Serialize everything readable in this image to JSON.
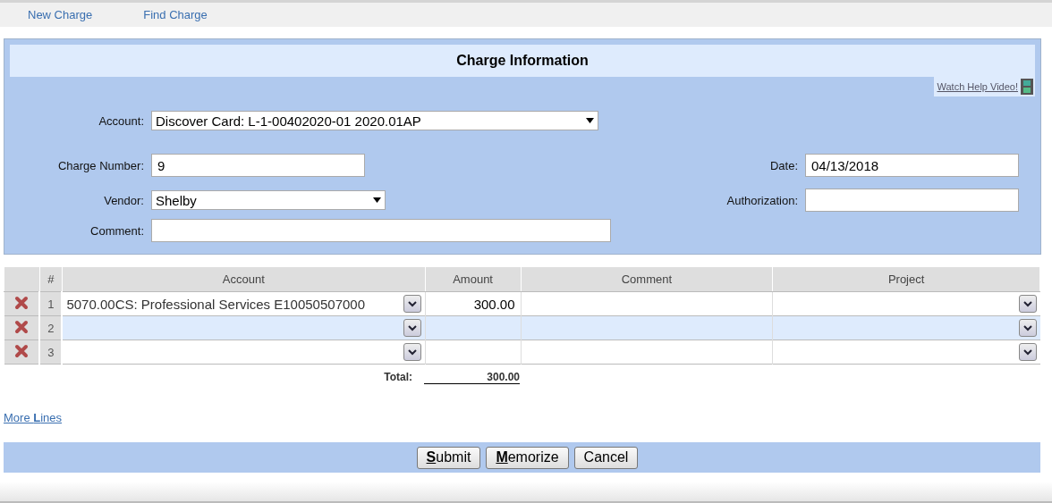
{
  "nav": [
    "New Charge",
    "Find Charge"
  ],
  "panel": {
    "title": "Charge Information",
    "help_link": "Watch Help Video!"
  },
  "fields": {
    "account": {
      "label": "Account:",
      "value": "Discover Card: L-1-00402020-01 2020.01AP"
    },
    "charge_number": {
      "label": "Charge Number:",
      "value": "9"
    },
    "date": {
      "label": "Date:",
      "value": "04/13/2018"
    },
    "vendor": {
      "label": "Vendor:",
      "value": "Shelby"
    },
    "authorization": {
      "label": "Authorization:"
    },
    "comment": {
      "label": "Comment:"
    }
  },
  "table": {
    "columns": [
      "#",
      "Account",
      "Amount",
      "Comment",
      "Project"
    ],
    "rows": [
      {
        "number": "1",
        "account": "5070.00CS: Professional Services E10050507000",
        "amount": "300.00",
        "selected": false
      },
      {
        "number": "2",
        "selected": true
      },
      {
        "number": "3",
        "selected": false
      }
    ],
    "total_label": "Total:",
    "total": "300.00"
  },
  "more_lines": "More **L**ines",
  "buttons": [
    "**S**ubmit",
    "**M**emorize",
    "Cancel"
  ]
}
